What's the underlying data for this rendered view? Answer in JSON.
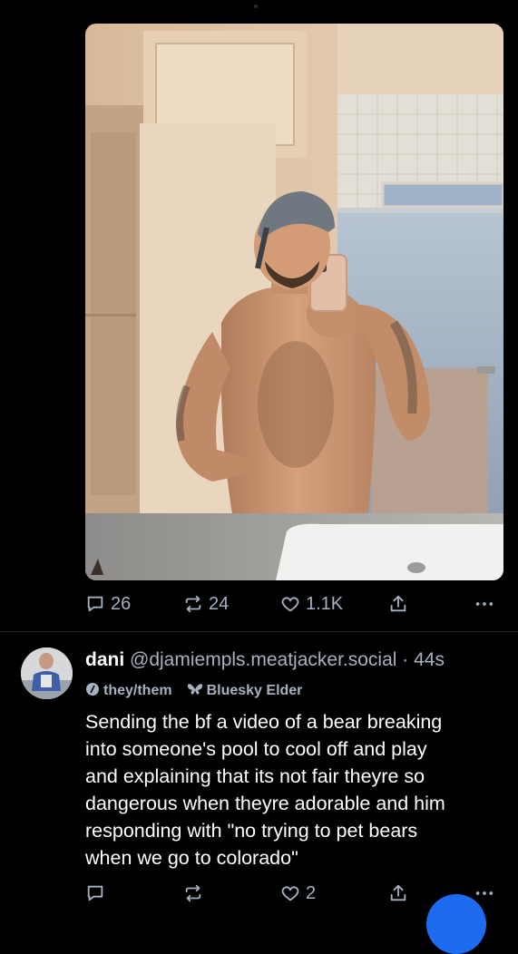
{
  "first_post": {
    "actions": {
      "reply_count": "26",
      "repost_count": "24",
      "like_count": "1.1K"
    },
    "icons": {
      "reply": "speech-bubble-icon",
      "repost": "repost-arrows-icon",
      "like": "heart-icon",
      "share": "share-upload-icon",
      "more": "ellipsis-icon"
    }
  },
  "second_post": {
    "author": {
      "display_name": "dani",
      "handle": "@djamiempls.meatjacker.social",
      "separator": " · ",
      "time": "44s"
    },
    "labels": [
      {
        "text": "they/them",
        "icon": "pronoun-badge-icon"
      },
      {
        "text": "Bluesky Elder",
        "icon": "butterfly-badge-icon"
      }
    ],
    "text": "Sending the bf a video of a bear breaking\ninto someone's pool to cool off and play\nand explaining that its not fair theyre so\ndangerous when theyre adorable and him\nresponding with \"no trying to pet bears\nwhen we go to colorado\"",
    "actions": {
      "reply_count": "",
      "repost_count": "",
      "like_count": "2"
    }
  },
  "colors": {
    "background": "#000000",
    "muted_text": "#a6b1c2",
    "divider": "#1f252d",
    "accent": "#1d6cf0"
  }
}
